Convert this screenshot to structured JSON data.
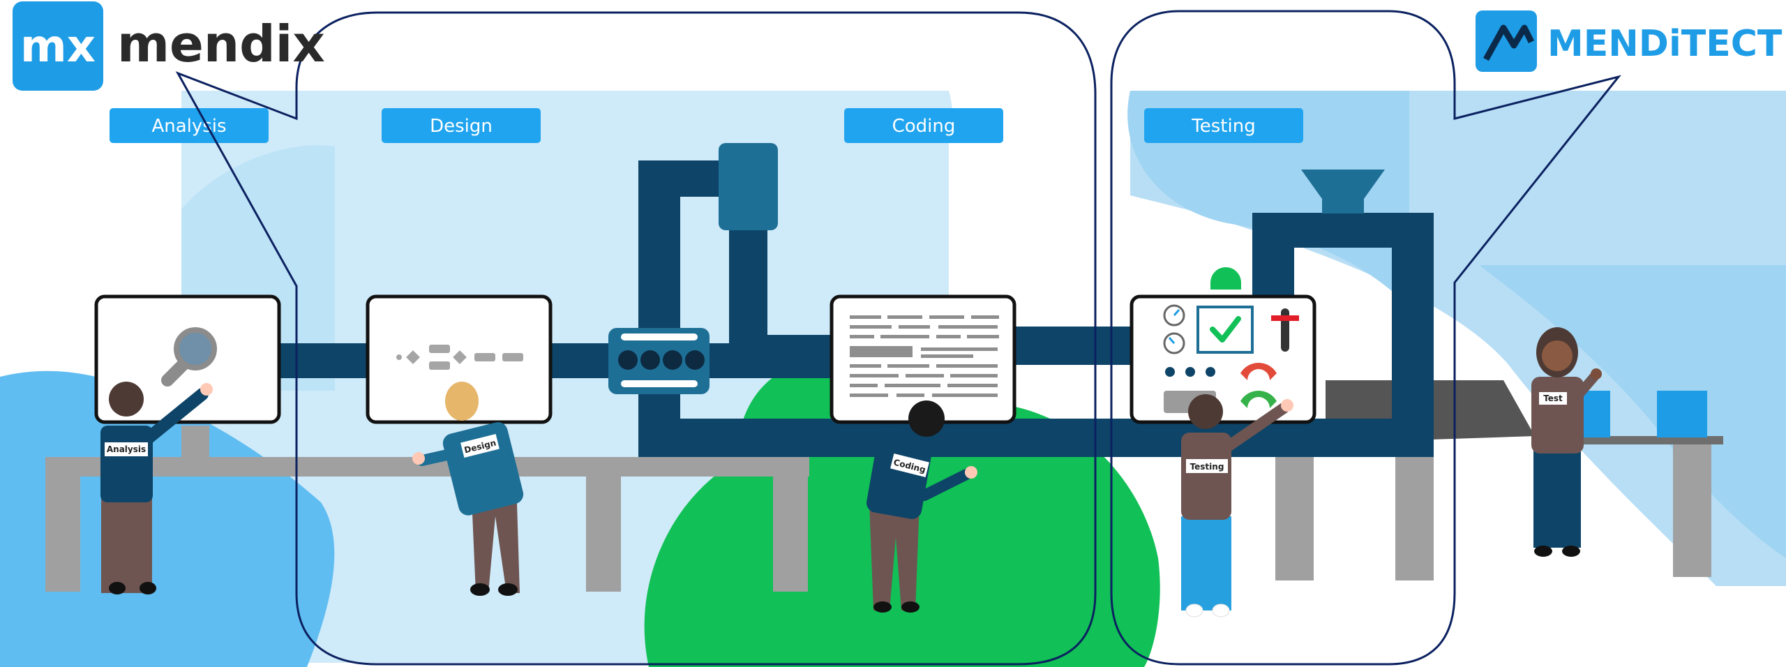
{
  "logos": {
    "mendix": {
      "mark": "mx",
      "name": "mendix",
      "color": "#1e9ce6"
    },
    "menditect": {
      "name": "MENDiTECT",
      "color": "#1e9ce6"
    }
  },
  "stages": [
    {
      "label": "Analysis"
    },
    {
      "label": "Design"
    },
    {
      "label": "Coding"
    },
    {
      "label": "Testing"
    }
  ],
  "workers": [
    {
      "badge": "Analysis"
    },
    {
      "badge": "Design"
    },
    {
      "badge": "Coding"
    },
    {
      "badge": "Testing"
    },
    {
      "badge": "Test"
    }
  ],
  "icons": [
    "magnifier-icon",
    "flowchart-icon",
    "code-lines-icon",
    "checkmark-icon",
    "gauge-icon",
    "hopper-icon"
  ],
  "colors": {
    "light_sky": "#cfeaf8",
    "mid_blue": "#60bdf2",
    "pipe_navy": "#0d4468",
    "pipe_teal": "#1e6f96",
    "grass": "#11c056",
    "table_grey": "#a0a0a0",
    "label_blue": "#20a4ef",
    "outline_navy": "#0b2160"
  }
}
